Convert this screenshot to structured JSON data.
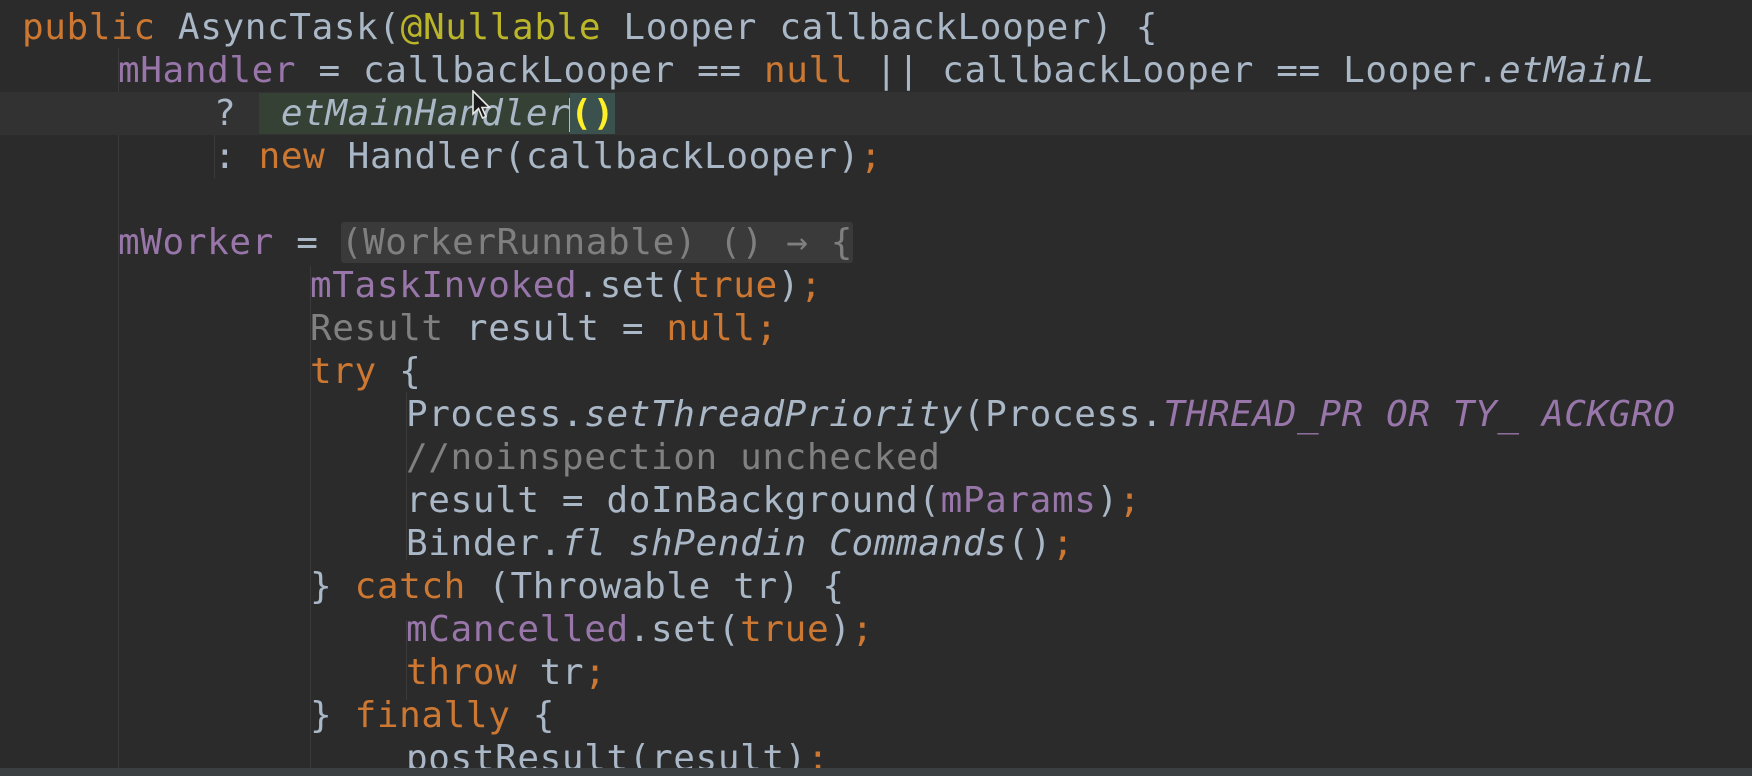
{
  "editor": {
    "language": "java",
    "lines": [
      {
        "current": false,
        "tokens": [
          {
            "t": "public ",
            "c": "kw"
          },
          {
            "t": "AsyncTask("
          },
          {
            "t": "@Nullable",
            "c": "ann"
          },
          {
            "t": " Looper callbackLooper) {"
          }
        ]
      },
      {
        "current": false,
        "tokens": [
          {
            "t": "mHandler",
            "c": "field"
          },
          {
            "t": " = callbackLooper == "
          },
          {
            "t": "null",
            "c": "kw"
          },
          {
            "t": " || callbackLooper == Looper."
          },
          {
            "t": "etMainL",
            "c": "fn-italic"
          }
        ]
      },
      {
        "current": true,
        "tokens": [
          {
            "t": "? "
          },
          {
            "t": " etMainHandler",
            "c": "fn-italic italic-hl"
          },
          {
            "t": "",
            "c": "caret"
          },
          {
            "t": "()",
            "c": "paren-hl"
          }
        ]
      },
      {
        "current": false,
        "tokens": [
          {
            "t": ": "
          },
          {
            "t": "new ",
            "c": "kw"
          },
          {
            "t": "Handler(callbackLooper)"
          },
          {
            "t": ";",
            "c": "kw"
          }
        ]
      },
      {
        "current": false,
        "tokens": []
      },
      {
        "current": false,
        "tokens": [
          {
            "t": "mWorker",
            "c": "field"
          },
          {
            "t": " = "
          },
          {
            "t": "(WorkerRunnable) () → {",
            "c": "hint"
          }
        ]
      },
      {
        "current": false,
        "tokens": [
          {
            "t": "mTaskInvoked",
            "c": "field"
          },
          {
            "t": ".set("
          },
          {
            "t": "true",
            "c": "kw"
          },
          {
            "t": ")"
          },
          {
            "t": ";",
            "c": "kw"
          }
        ]
      },
      {
        "current": false,
        "tokens": [
          {
            "t": "Result",
            "c": "type-gray"
          },
          {
            "t": " result = "
          },
          {
            "t": "null",
            "c": "kw"
          },
          {
            "t": ";",
            "c": "kw"
          }
        ]
      },
      {
        "current": false,
        "tokens": [
          {
            "t": "try",
            "c": "kw"
          },
          {
            "t": " {"
          }
        ]
      },
      {
        "current": false,
        "tokens": [
          {
            "t": "Process."
          },
          {
            "t": "setThreadPriority",
            "c": "fn-italic"
          },
          {
            "t": "(Process."
          },
          {
            "t": "THREAD_PR OR TY_ ACKGRO",
            "c": "const"
          }
        ]
      },
      {
        "current": false,
        "tokens": [
          {
            "t": "//noinspection unchecked",
            "c": "comment"
          }
        ]
      },
      {
        "current": false,
        "tokens": [
          {
            "t": "result = doInBackground("
          },
          {
            "t": "mParams",
            "c": "field"
          },
          {
            "t": ")"
          },
          {
            "t": ";",
            "c": "kw"
          }
        ]
      },
      {
        "current": false,
        "tokens": [
          {
            "t": "Binder."
          },
          {
            "t": "fl shPendin Commands",
            "c": "fn-italic"
          },
          {
            "t": "()"
          },
          {
            "t": ";",
            "c": "kw"
          }
        ]
      },
      {
        "current": false,
        "tokens": [
          {
            "t": "} "
          },
          {
            "t": "catch",
            "c": "kw"
          },
          {
            "t": " (Throwable tr) {"
          }
        ]
      },
      {
        "current": false,
        "tokens": [
          {
            "t": "mCancelled",
            "c": "field"
          },
          {
            "t": ".set("
          },
          {
            "t": "true",
            "c": "kw"
          },
          {
            "t": ")"
          },
          {
            "t": ";",
            "c": "kw"
          }
        ]
      },
      {
        "current": false,
        "tokens": [
          {
            "t": "throw",
            "c": "kw"
          },
          {
            "t": " tr"
          },
          {
            "t": ";",
            "c": "kw"
          }
        ]
      },
      {
        "current": false,
        "tokens": [
          {
            "t": "} "
          },
          {
            "t": "finally",
            "c": "kw"
          },
          {
            "t": " {"
          }
        ]
      },
      {
        "current": false,
        "tokens": [
          {
            "t": "postResult(result)"
          },
          {
            "t": ";",
            "c": "kw"
          }
        ]
      }
    ]
  },
  "colors": {
    "background": "#2b2b2b",
    "current_line": "#323232",
    "default_text": "#a9b7c6",
    "keyword": "#cc7832",
    "annotation": "#bbb529",
    "field": "#9876aa",
    "comment": "#808080"
  },
  "cursor_icon": "mouse-arrow-icon"
}
